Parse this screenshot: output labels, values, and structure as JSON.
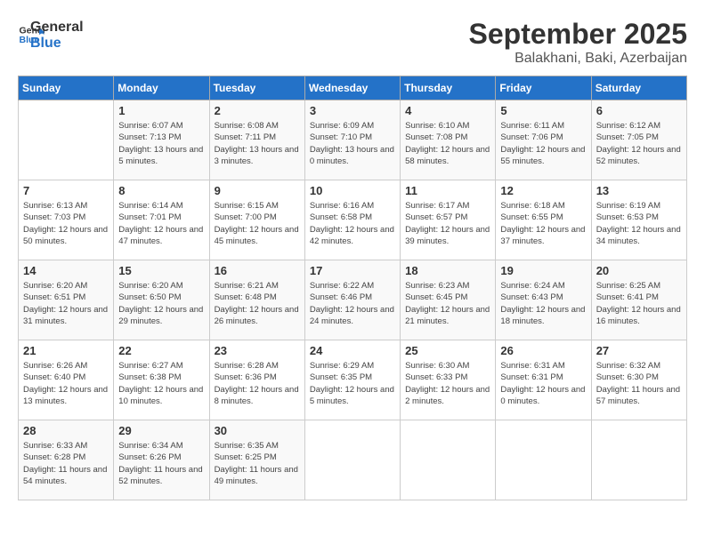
{
  "header": {
    "logo_line1": "General",
    "logo_line2": "Blue",
    "month_title": "September 2025",
    "location": "Balakhani, Baki, Azerbaijan"
  },
  "days_of_week": [
    "Sunday",
    "Monday",
    "Tuesday",
    "Wednesday",
    "Thursday",
    "Friday",
    "Saturday"
  ],
  "weeks": [
    [
      {
        "day": "",
        "sunrise": "",
        "sunset": "",
        "daylight": ""
      },
      {
        "day": "1",
        "sunrise": "Sunrise: 6:07 AM",
        "sunset": "Sunset: 7:13 PM",
        "daylight": "Daylight: 13 hours and 5 minutes."
      },
      {
        "day": "2",
        "sunrise": "Sunrise: 6:08 AM",
        "sunset": "Sunset: 7:11 PM",
        "daylight": "Daylight: 13 hours and 3 minutes."
      },
      {
        "day": "3",
        "sunrise": "Sunrise: 6:09 AM",
        "sunset": "Sunset: 7:10 PM",
        "daylight": "Daylight: 13 hours and 0 minutes."
      },
      {
        "day": "4",
        "sunrise": "Sunrise: 6:10 AM",
        "sunset": "Sunset: 7:08 PM",
        "daylight": "Daylight: 12 hours and 58 minutes."
      },
      {
        "day": "5",
        "sunrise": "Sunrise: 6:11 AM",
        "sunset": "Sunset: 7:06 PM",
        "daylight": "Daylight: 12 hours and 55 minutes."
      },
      {
        "day": "6",
        "sunrise": "Sunrise: 6:12 AM",
        "sunset": "Sunset: 7:05 PM",
        "daylight": "Daylight: 12 hours and 52 minutes."
      }
    ],
    [
      {
        "day": "7",
        "sunrise": "Sunrise: 6:13 AM",
        "sunset": "Sunset: 7:03 PM",
        "daylight": "Daylight: 12 hours and 50 minutes."
      },
      {
        "day": "8",
        "sunrise": "Sunrise: 6:14 AM",
        "sunset": "Sunset: 7:01 PM",
        "daylight": "Daylight: 12 hours and 47 minutes."
      },
      {
        "day": "9",
        "sunrise": "Sunrise: 6:15 AM",
        "sunset": "Sunset: 7:00 PM",
        "daylight": "Daylight: 12 hours and 45 minutes."
      },
      {
        "day": "10",
        "sunrise": "Sunrise: 6:16 AM",
        "sunset": "Sunset: 6:58 PM",
        "daylight": "Daylight: 12 hours and 42 minutes."
      },
      {
        "day": "11",
        "sunrise": "Sunrise: 6:17 AM",
        "sunset": "Sunset: 6:57 PM",
        "daylight": "Daylight: 12 hours and 39 minutes."
      },
      {
        "day": "12",
        "sunrise": "Sunrise: 6:18 AM",
        "sunset": "Sunset: 6:55 PM",
        "daylight": "Daylight: 12 hours and 37 minutes."
      },
      {
        "day": "13",
        "sunrise": "Sunrise: 6:19 AM",
        "sunset": "Sunset: 6:53 PM",
        "daylight": "Daylight: 12 hours and 34 minutes."
      }
    ],
    [
      {
        "day": "14",
        "sunrise": "Sunrise: 6:20 AM",
        "sunset": "Sunset: 6:51 PM",
        "daylight": "Daylight: 12 hours and 31 minutes."
      },
      {
        "day": "15",
        "sunrise": "Sunrise: 6:20 AM",
        "sunset": "Sunset: 6:50 PM",
        "daylight": "Daylight: 12 hours and 29 minutes."
      },
      {
        "day": "16",
        "sunrise": "Sunrise: 6:21 AM",
        "sunset": "Sunset: 6:48 PM",
        "daylight": "Daylight: 12 hours and 26 minutes."
      },
      {
        "day": "17",
        "sunrise": "Sunrise: 6:22 AM",
        "sunset": "Sunset: 6:46 PM",
        "daylight": "Daylight: 12 hours and 24 minutes."
      },
      {
        "day": "18",
        "sunrise": "Sunrise: 6:23 AM",
        "sunset": "Sunset: 6:45 PM",
        "daylight": "Daylight: 12 hours and 21 minutes."
      },
      {
        "day": "19",
        "sunrise": "Sunrise: 6:24 AM",
        "sunset": "Sunset: 6:43 PM",
        "daylight": "Daylight: 12 hours and 18 minutes."
      },
      {
        "day": "20",
        "sunrise": "Sunrise: 6:25 AM",
        "sunset": "Sunset: 6:41 PM",
        "daylight": "Daylight: 12 hours and 16 minutes."
      }
    ],
    [
      {
        "day": "21",
        "sunrise": "Sunrise: 6:26 AM",
        "sunset": "Sunset: 6:40 PM",
        "daylight": "Daylight: 12 hours and 13 minutes."
      },
      {
        "day": "22",
        "sunrise": "Sunrise: 6:27 AM",
        "sunset": "Sunset: 6:38 PM",
        "daylight": "Daylight: 12 hours and 10 minutes."
      },
      {
        "day": "23",
        "sunrise": "Sunrise: 6:28 AM",
        "sunset": "Sunset: 6:36 PM",
        "daylight": "Daylight: 12 hours and 8 minutes."
      },
      {
        "day": "24",
        "sunrise": "Sunrise: 6:29 AM",
        "sunset": "Sunset: 6:35 PM",
        "daylight": "Daylight: 12 hours and 5 minutes."
      },
      {
        "day": "25",
        "sunrise": "Sunrise: 6:30 AM",
        "sunset": "Sunset: 6:33 PM",
        "daylight": "Daylight: 12 hours and 2 minutes."
      },
      {
        "day": "26",
        "sunrise": "Sunrise: 6:31 AM",
        "sunset": "Sunset: 6:31 PM",
        "daylight": "Daylight: 12 hours and 0 minutes."
      },
      {
        "day": "27",
        "sunrise": "Sunrise: 6:32 AM",
        "sunset": "Sunset: 6:30 PM",
        "daylight": "Daylight: 11 hours and 57 minutes."
      }
    ],
    [
      {
        "day": "28",
        "sunrise": "Sunrise: 6:33 AM",
        "sunset": "Sunset: 6:28 PM",
        "daylight": "Daylight: 11 hours and 54 minutes."
      },
      {
        "day": "29",
        "sunrise": "Sunrise: 6:34 AM",
        "sunset": "Sunset: 6:26 PM",
        "daylight": "Daylight: 11 hours and 52 minutes."
      },
      {
        "day": "30",
        "sunrise": "Sunrise: 6:35 AM",
        "sunset": "Sunset: 6:25 PM",
        "daylight": "Daylight: 11 hours and 49 minutes."
      },
      {
        "day": "",
        "sunrise": "",
        "sunset": "",
        "daylight": ""
      },
      {
        "day": "",
        "sunrise": "",
        "sunset": "",
        "daylight": ""
      },
      {
        "day": "",
        "sunrise": "",
        "sunset": "",
        "daylight": ""
      },
      {
        "day": "",
        "sunrise": "",
        "sunset": "",
        "daylight": ""
      }
    ]
  ]
}
